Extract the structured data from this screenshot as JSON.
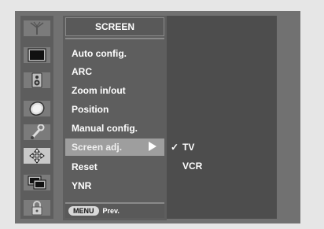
{
  "menu": {
    "title": "SCREEN",
    "items": [
      {
        "label": "Auto config."
      },
      {
        "label": "ARC"
      },
      {
        "label": "Zoom in/out"
      },
      {
        "label": "Position"
      },
      {
        "label": "Manual config."
      },
      {
        "label": "Screen adj."
      },
      {
        "label": "Reset"
      },
      {
        "label": "YNR"
      }
    ],
    "selected_index": 5
  },
  "submenu": {
    "check_mark": "✓",
    "options": [
      {
        "label": "TV",
        "checked": true
      },
      {
        "label": "VCR",
        "checked": false
      }
    ]
  },
  "footer": {
    "menu_button": "MENU",
    "prev_label": "Prev."
  },
  "icons": [
    "antenna-icon",
    "monitor-icon",
    "speaker-icon",
    "clock-icon",
    "wrench-icon",
    "screen-move-icon",
    "pip-icon",
    "lock-icon"
  ],
  "colors": {
    "background": "#e6e6e6",
    "frame": "#717171",
    "menu_panel": "#5e5e5e",
    "submenu_panel": "#4d4d4d",
    "selected_row": "#9e9e9e",
    "text": "#ffffff"
  }
}
